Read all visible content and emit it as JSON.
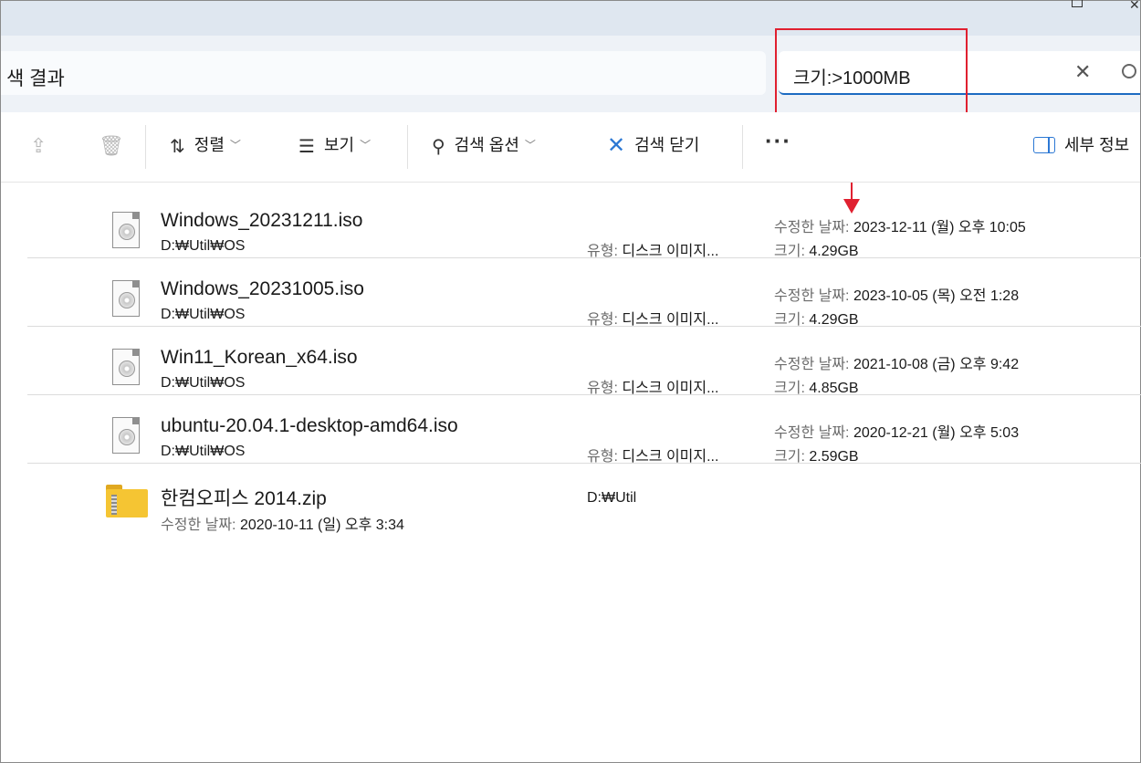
{
  "address": {
    "text": "색 결과"
  },
  "search": {
    "query": "크기:>1000MB",
    "clear_symbol": "✕"
  },
  "toolbar": {
    "sort_label": "정렬",
    "view_label": "보기",
    "search_options_label": "검색 옵션",
    "close_search_label": "검색 닫기",
    "more_label": "···",
    "details_label": "세부 정보"
  },
  "labels": {
    "modified": "수정한 날짜:",
    "size": "크기:",
    "type": "유형:"
  },
  "files": [
    {
      "name": "Windows_20231211.iso",
      "path": "D:₩Util₩OS",
      "type": "디스크 이미지...",
      "modified": "2023-12-11 (월) 오후 10:05",
      "size": "4.29GB"
    },
    {
      "name": "Windows_20231005.iso",
      "path": "D:₩Util₩OS",
      "type": "디스크 이미지...",
      "modified": "2023-10-05 (목) 오전 1:28",
      "size": "4.29GB"
    },
    {
      "name": "Win11_Korean_x64.iso",
      "path": "D:₩Util₩OS",
      "type": "디스크 이미지...",
      "modified": "2021-10-08 (금) 오후 9:42",
      "size": "4.85GB"
    },
    {
      "name": "ubuntu-20.04.1-desktop-amd64.iso",
      "path": "D:₩Util₩OS",
      "type": "디스크 이미지...",
      "modified": "2020-12-21 (월) 오후 5:03",
      "size": "2.59GB"
    }
  ],
  "zip_file": {
    "name": "한컴오피스 2014.zip",
    "modified": "2020-10-11 (일) 오후 3:34",
    "location": "D:₩Util"
  },
  "annotation_color": "#e02030",
  "accent_color": "#1c6bc2"
}
